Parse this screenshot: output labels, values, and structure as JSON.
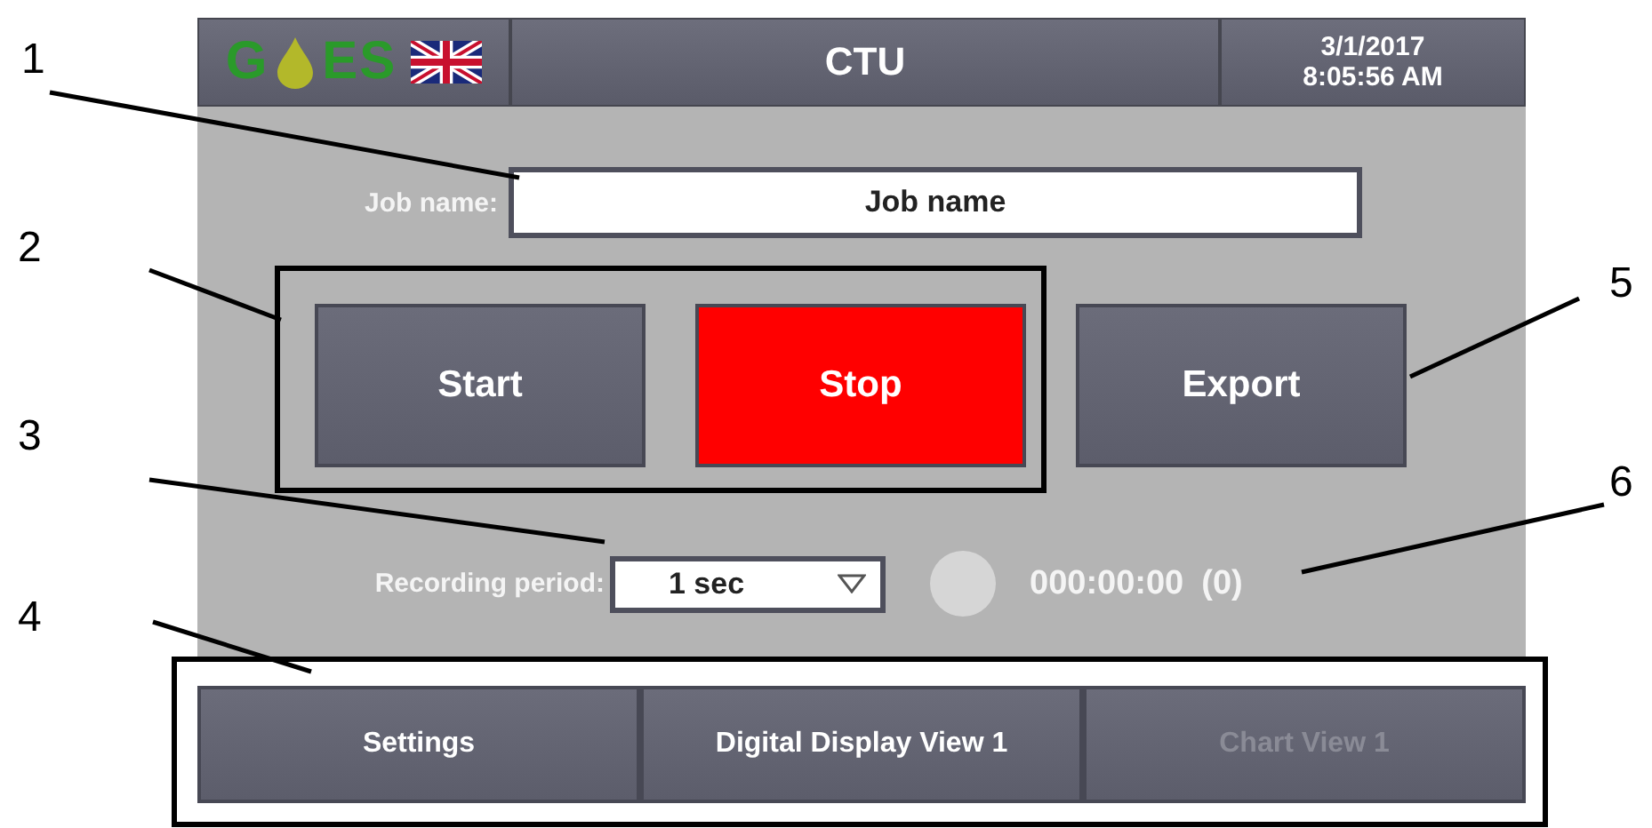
{
  "header": {
    "logo": [
      "G",
      "ES"
    ],
    "title": "CTU",
    "date": "3/1/2017",
    "time": "8:05:56 AM"
  },
  "job": {
    "label": "Job name:",
    "value": "Job name"
  },
  "actions": [
    {
      "label": "Start",
      "kind": "normal"
    },
    {
      "label": "Stop",
      "kind": "alarm"
    },
    {
      "label": "Export",
      "kind": "normal"
    }
  ],
  "recording": {
    "label": "Recording period:",
    "period": "1 sec",
    "active": false,
    "elapsed": "000:00:00",
    "count": "(0)"
  },
  "nav": [
    {
      "label": "Settings",
      "disabled": false
    },
    {
      "label": "Digital Display View 1",
      "disabled": false
    },
    {
      "label": "Chart View 1",
      "disabled": true
    }
  ],
  "callouts": [
    "1",
    "2",
    "3",
    "4",
    "5",
    "6"
  ]
}
